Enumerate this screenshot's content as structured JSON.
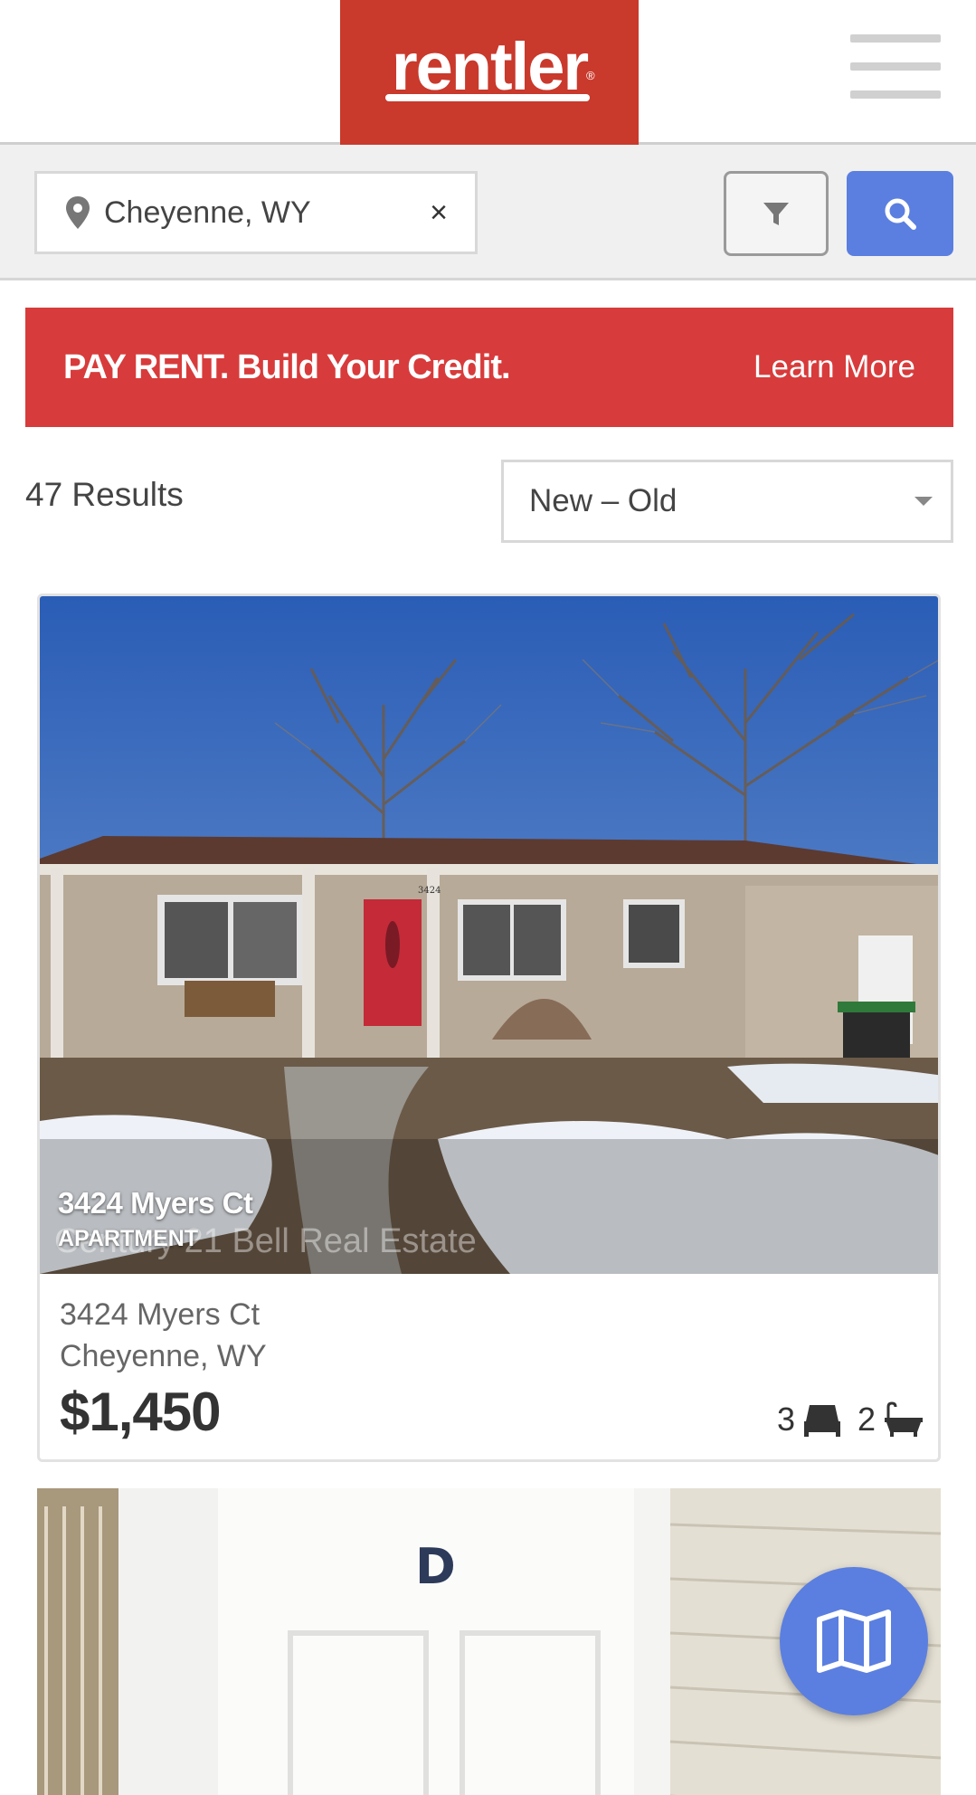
{
  "header": {
    "logo_text": "rentler",
    "logo_reg": "®",
    "brand_color": "#c9392c"
  },
  "search": {
    "location_value": "Cheyenne, WY",
    "clear_glyph": "×",
    "pin_icon": "map-pin-icon",
    "filter_icon": "filter-icon",
    "search_icon": "search-icon",
    "accent_color": "#5b7fe0"
  },
  "banner": {
    "text": "PAY RENT. Build Your Credit.",
    "link": "Learn More",
    "color": "#d83b3b"
  },
  "results": {
    "count_label": "47 Results",
    "sort_selected": "New – Old"
  },
  "listings": [
    {
      "overlay_title": "3424 Myers Ct",
      "overlay_type": "APARTMENT",
      "watermark": "Century 21 Bell Real Estate",
      "address_line1": "3424 Myers Ct",
      "address_line2": "Cheyenne, WY",
      "price": "$1,450",
      "beds": "3",
      "baths": "2",
      "house_number": "3424"
    },
    {
      "door_letter": "D"
    }
  ],
  "map_button_icon": "map-icon"
}
